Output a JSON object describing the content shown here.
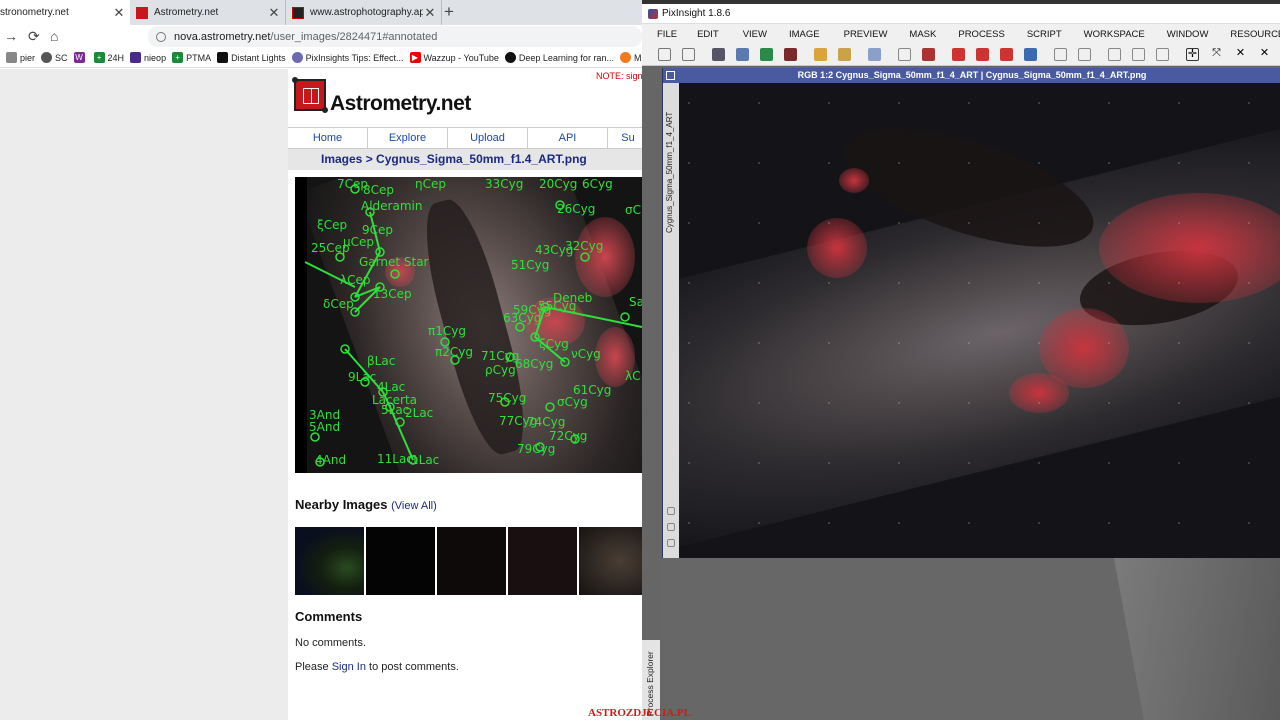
{
  "browser": {
    "tabs": [
      {
        "title": "stronometry.net",
        "active": true
      },
      {
        "title": "Astrometry.net",
        "active": false
      },
      {
        "title": "www.astrophotography.app",
        "active": false
      }
    ],
    "url_host": "nova.astrometry.net",
    "url_path": "/user_images/2824471#annotated",
    "bookmarks": [
      "pier",
      "SC",
      "",
      "24H",
      "nieop",
      "PTMA",
      "Distant Lights",
      "PixInsights Tips: Effect...",
      "Wazzup - YouTube",
      "Deep Learning for ran...",
      "M"
    ]
  },
  "astrometry": {
    "note": "NOTE: sign",
    "site_name": "Astrometry.net",
    "nav": [
      "Home",
      "Explore",
      "Upload",
      "API",
      "Su"
    ],
    "breadcrumb": "Images > Cygnus_Sigma_50mm_f1.4_ART.png",
    "annotations": [
      "7Cep",
      "8Cep",
      "ηCep",
      "33Cyg",
      "20Cyg",
      "6Cyg",
      "Alderamin",
      "26Cyg",
      "σC",
      "ξCep",
      "9Cep",
      "25Cep",
      "μCep",
      "Garnet Star",
      "43Cyg",
      "32Cyg",
      "51Cyg",
      "λCep",
      "13Cep",
      "δCep",
      "Deneb",
      "59Cyg",
      "55Cyg",
      "63Cyg",
      "π1Cyg",
      "π2Cyg",
      "71Cyg",
      "68Cyg",
      "ξCyg",
      "νCyg",
      "βLac",
      "9Lac",
      "4Lac",
      "Lacerta",
      "5Lac",
      "2Lac",
      "61Cyg",
      "σCyg",
      "75Cyg",
      "λC",
      "3And",
      "5And",
      "77Cyg",
      "74Cyg",
      "72Cyg",
      "79Cyg",
      "4And",
      "11Lac",
      "1Lac",
      "ρCyg",
      "Sa"
    ],
    "nearby_title": "Nearby Images",
    "nearby_link": "(View All)",
    "comments_title": "Comments",
    "no_comments": "No comments.",
    "signin_prefix": "Please ",
    "signin_link": "Sign In",
    "signin_suffix": " to post comments."
  },
  "pixinsight": {
    "app_title": "PixInsight 1.8.6",
    "menu": [
      "FILE",
      "EDIT",
      "VIEW",
      "IMAGE",
      "PREVIEW",
      "MASK",
      "PROCESS",
      "SCRIPT",
      "WORKSPACE",
      "WINDOW",
      "RESOURCES"
    ],
    "image_window_title": "RGB 1:2 Cygnus_Sigma_50mm_f1_4_ART | Cygnus_Sigma_50mm_f1_4_ART.png",
    "image_side_label": "Cygnus_Sigma_50mm_f1_4_ART",
    "side_panel_label": "Process Explorer"
  },
  "watermark": "ASTROZDJECIA.PL",
  "colors": {
    "annotation_green": "#2ee03a",
    "link_blue": "#1a2a80",
    "pix_window_title": "#4a5aa0",
    "watermark_red": "#d21a1a"
  }
}
